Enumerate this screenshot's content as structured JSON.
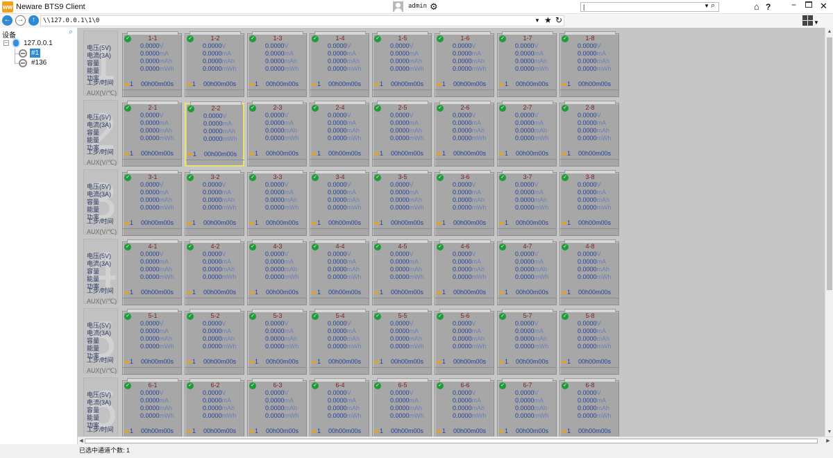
{
  "app": {
    "title": "Neware BTS9 Client",
    "logo_text": "ww"
  },
  "header": {
    "user": "admin",
    "search": {
      "value": "|"
    }
  },
  "address": {
    "path": "\\\\127.0.0.1\\1\\0"
  },
  "tree": {
    "header": "设备",
    "root": {
      "label": "127.0.0.1",
      "expand": "−"
    },
    "items": [
      {
        "label": "#1",
        "selected": true
      },
      {
        "label": "#136",
        "selected": false
      }
    ]
  },
  "unit_labels": {
    "fields": [
      "电压(5V)",
      "电流(3A)",
      "容量",
      "能量",
      "功率"
    ],
    "step": "工步/时间",
    "aux": "AUX(V/℃)"
  },
  "units": [
    "1",
    "2",
    "3",
    "4",
    "5",
    "6"
  ],
  "channels_per_unit": 8,
  "channel_defaults": {
    "status": "ok",
    "voltage": "0.0000",
    "voltage_unit": "V",
    "current": "0.0000",
    "current_unit": "mA",
    "capacity": "0.0000",
    "capacity_unit": "mAh",
    "energy": "0.0000",
    "energy_unit": "mWh",
    "step": "1",
    "time": "00h00m00s"
  },
  "selected_channel": "2-2",
  "status": {
    "text": "已选中通道个数: 1"
  },
  "colors": {
    "ok": "#1f9c3a",
    "selected_border": "#e6e26e",
    "accent": "#2f8ad2",
    "step_marker": "#e8a418"
  }
}
